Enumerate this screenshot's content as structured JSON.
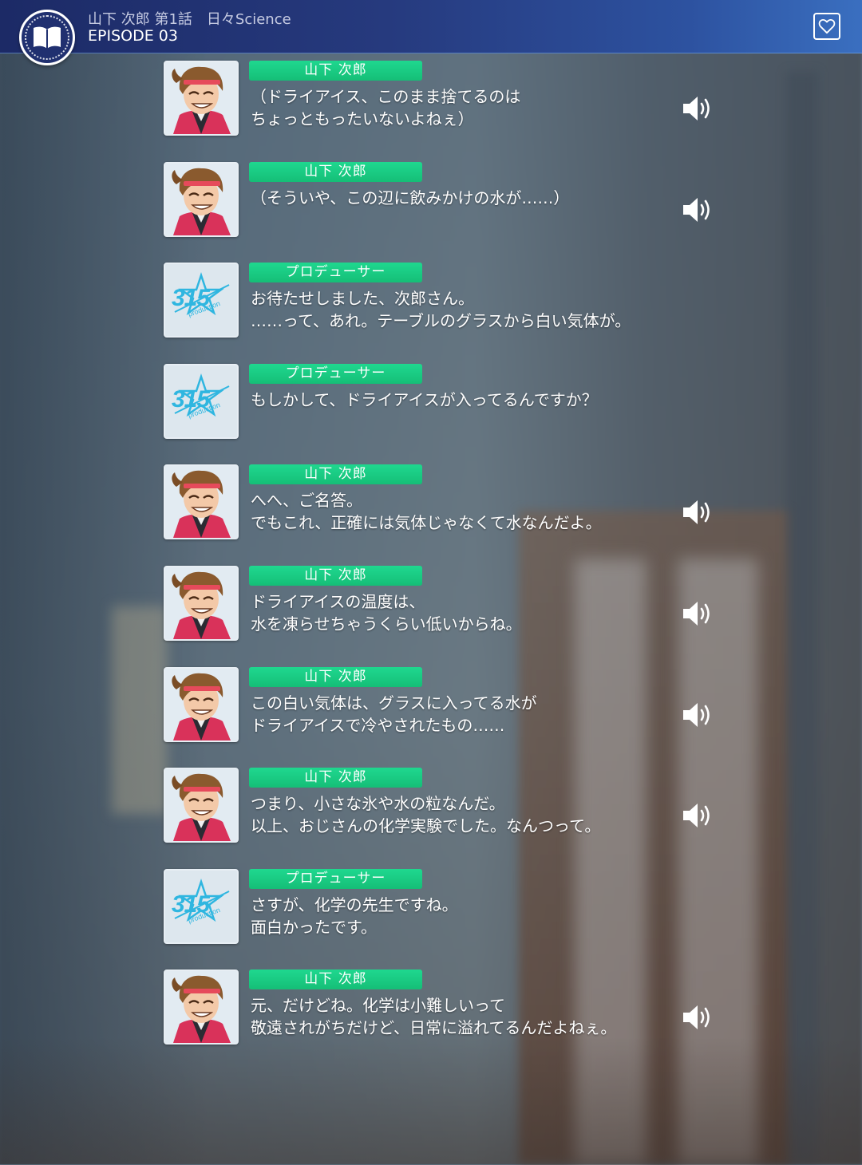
{
  "header": {
    "episode_title": "山下 次郎 第1話　日々Science",
    "episode_number": "EPISODE 03"
  },
  "speakers": {
    "jiro": "山下 次郎",
    "producer": "プロデューサー"
  },
  "log": [
    {
      "speaker": "山下 次郎",
      "portrait": "jiro-portrait",
      "lines": [
        "（ドライアイス、このまま捨てるのは",
        "ちょっともったいないよねぇ）"
      ],
      "voice": true
    },
    {
      "speaker": "山下 次郎",
      "portrait": "jiro-portrait",
      "lines": [
        "（そういや、この辺に飲みかけの水が……）",
        ""
      ],
      "voice": true
    },
    {
      "speaker": "プロデューサー",
      "portrait": "315-production-logo",
      "lines": [
        "お待たせしました、次郎さん。",
        "……って、あれ。テーブルのグラスから白い気体が。"
      ],
      "voice": false
    },
    {
      "speaker": "プロデューサー",
      "portrait": "315-production-logo",
      "lines": [
        "もしかして、ドライアイスが入ってるんですか？",
        ""
      ],
      "voice": false
    },
    {
      "speaker": "山下 次郎",
      "portrait": "jiro-portrait",
      "lines": [
        "へへ、ご名答。",
        "でもこれ、正確には気体じゃなくて水なんだよ。"
      ],
      "voice": true
    },
    {
      "speaker": "山下 次郎",
      "portrait": "jiro-portrait",
      "lines": [
        "ドライアイスの温度は、",
        "水を凍らせちゃうくらい低いからね。"
      ],
      "voice": true
    },
    {
      "speaker": "山下 次郎",
      "portrait": "jiro-portrait",
      "lines": [
        "この白い気体は、グラスに入ってる水が",
        "ドライアイスで冷やされたもの……"
      ],
      "voice": true
    },
    {
      "speaker": "山下 次郎",
      "portrait": "jiro-portrait",
      "lines": [
        "つまり、小さな氷や水の粒なんだ。",
        "以上、おじさんの化学実験でした。なんつって。"
      ],
      "voice": true
    },
    {
      "speaker": "プロデューサー",
      "portrait": "315-production-logo",
      "lines": [
        "さすが、化学の先生ですね。",
        "面白かったです。"
      ],
      "voice": false
    },
    {
      "speaker": "山下 次郎",
      "portrait": "jiro-portrait",
      "lines": [
        "元、だけどね。化学は小難しいって",
        "敬遠されがちだけど、日常に溢れてるんだよねぇ。"
      ],
      "voice": true
    }
  ],
  "logo_text": {
    "number": "315",
    "sub": "production"
  },
  "colors": {
    "header_start": "#1c2a66",
    "header_end": "#3a6fc0",
    "name_tag": "#1fd88f",
    "text": "#ffffff"
  },
  "icons": {
    "badge": "open-book-icon",
    "favorite": "heart-icon",
    "voice": "speaker-volume-icon"
  }
}
